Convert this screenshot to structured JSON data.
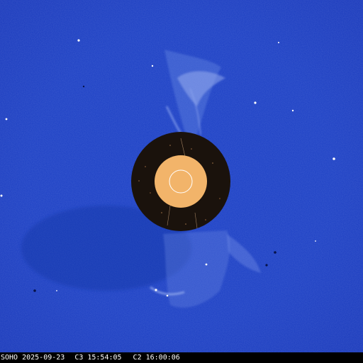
{
  "caption": {
    "observatory": "SOHO",
    "date": "2025-09-23",
    "c3_time": "C3 15:54:05",
    "c2_time": "C2 16:00:06"
  },
  "colors": {
    "sky": "#1b3fc4",
    "sky_dark": "#1436b0",
    "occulter_ring": "#1a120c",
    "inner_disk": "#f2b46a",
    "sun_outline": "#ffffff",
    "caption_text": "#ffffff",
    "caption_bg": "#000000"
  },
  "image": {
    "subject": "LASCO coronagraph composite",
    "icons": [
      "occulter-disk-icon",
      "sun-outline-icon",
      "star-field"
    ]
  }
}
